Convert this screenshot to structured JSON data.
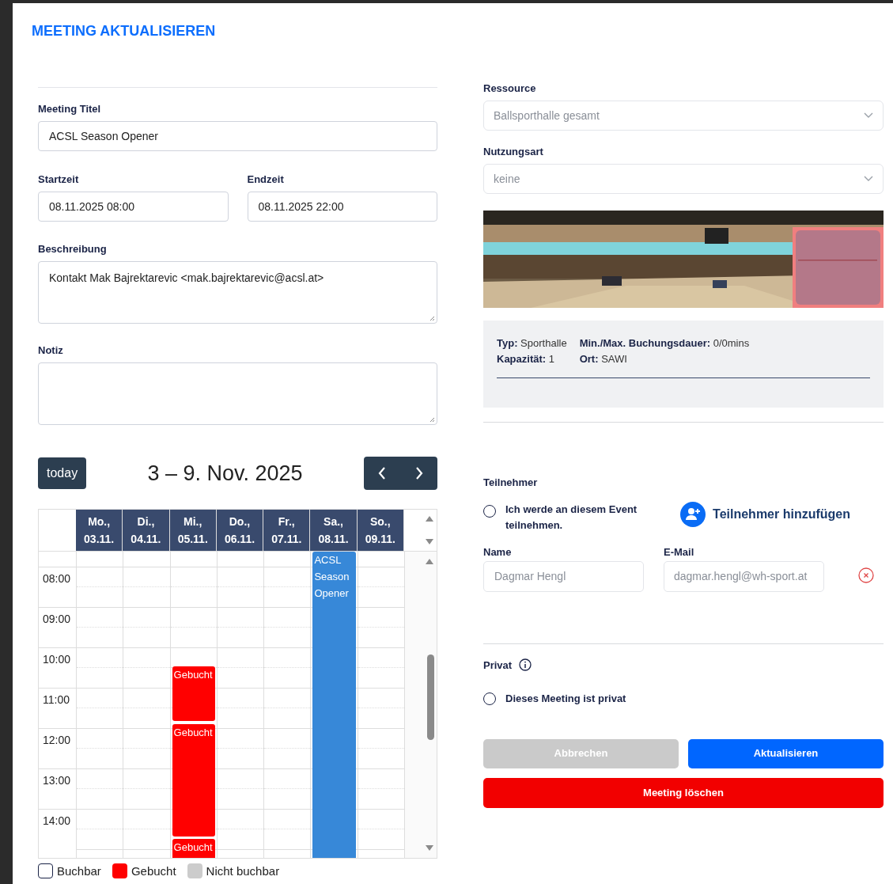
{
  "title": "MEETING AKTUALISIEREN",
  "meeting_title": {
    "label": "Meeting Titel",
    "value": "ACSL Season Opener"
  },
  "start": {
    "label": "Startzeit",
    "value": "08.11.2025 08:00"
  },
  "end": {
    "label": "Endzeit",
    "value": "08.11.2025 22:00"
  },
  "description": {
    "label": "Beschreibung",
    "value": "Kontakt Mak Bajrektarevic <mak.bajrektarevic@acsl.at>"
  },
  "note": {
    "label": "Notiz"
  },
  "calendar": {
    "today_button": "today",
    "range_title": "3 – 9. Nov. 2025",
    "days": [
      {
        "weekday": "Mo.,",
        "date": "03.11."
      },
      {
        "weekday": "Di.,",
        "date": "04.11."
      },
      {
        "weekday": "Mi.,",
        "date": "05.11."
      },
      {
        "weekday": "Do.,",
        "date": "06.11."
      },
      {
        "weekday": "Fr.,",
        "date": "07.11."
      },
      {
        "weekday": "Sa.,",
        "date": "08.11."
      },
      {
        "weekday": "So.,",
        "date": "09.11."
      }
    ],
    "hours": [
      "08:00",
      "09:00",
      "10:00",
      "11:00",
      "12:00",
      "13:00",
      "14:00"
    ],
    "events": [
      {
        "label": "ACSL Season Opener",
        "kind": "meeting"
      },
      {
        "label": "Gebucht",
        "kind": "booked"
      },
      {
        "label": "Gebucht",
        "kind": "booked"
      },
      {
        "label": "Gebucht",
        "kind": "booked"
      }
    ]
  },
  "legend": [
    {
      "label": "Buchbar",
      "kind": "available"
    },
    {
      "label": "Gebucht",
      "kind": "booked"
    },
    {
      "label": "Nicht buchbar",
      "kind": "unavailable"
    }
  ],
  "resource": {
    "label": "Ressource",
    "value": "Ballsporthalle gesamt",
    "disabled": true
  },
  "usage": {
    "label": "Nutzungsart",
    "value": "keine",
    "disabled": true
  },
  "details": [
    {
      "label": "Typ:",
      "value": "Sporthalle"
    },
    {
      "label": "Min./Max. Buchungsdauer:",
      "value": "0/0mins"
    },
    {
      "label": "Kapazität:",
      "value": "1"
    },
    {
      "label": "Ort:",
      "value": "SAWI"
    }
  ],
  "participants": {
    "heading": "Teilnehmer",
    "attend": {
      "label": "Ich werde an diesem Event teilnehmen.",
      "checked": false
    },
    "add_button": "Teilnehmer hinzufügen",
    "rows": [
      {
        "name_label": "Name",
        "email_label": "E-Mail",
        "name": "Dagmar Hengl",
        "email": "dagmar.hengl@wh-sport.at",
        "disabled": true
      }
    ]
  },
  "privacy": {
    "heading": "Privat",
    "option": {
      "label": "Dieses Meeting ist privat",
      "checked": false
    }
  },
  "buttons": [
    {
      "label": "Abbrechen",
      "kind": "cancel",
      "disabled": true
    },
    {
      "label": "Aktualisieren",
      "kind": "primary",
      "disabled": false
    },
    {
      "label": "Meeting löschen",
      "kind": "danger",
      "disabled": false
    }
  ]
}
